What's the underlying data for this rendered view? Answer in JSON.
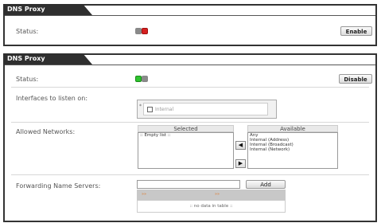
{
  "panel1": {
    "tab_title": "DNS Proxy",
    "status_label": "Status:",
    "enable_label": "Enable"
  },
  "panel2": {
    "tab_title": "DNS Proxy",
    "status_label": "Status:",
    "disable_label": "Disable",
    "interfaces_label": "Interfaces to listen on:",
    "interface_option": "Internal",
    "allowed_networks_label": "Allowed Networks:",
    "selected_header": "Selected",
    "available_header": "Available",
    "selected_items": [
      ":: Empty list ::"
    ],
    "available_items": [
      "Any",
      "Internal (Address)",
      "Internal (Broadcast)",
      "Internal (Network)"
    ],
    "forwarding_label": "Forwarding Name Servers:",
    "add_label": "Add",
    "no_data": ":: no data in table ::"
  },
  "colors": {
    "led_off_gray": "#8a8a8a",
    "led_red": "#d62020",
    "led_green": "#2ec42e",
    "tab_dark": "#2f2f2f",
    "arrow_orange": "#e07a2c"
  },
  "icons": {
    "move_left": "◀",
    "move_right": "▶",
    "sort_arrows": "»»"
  }
}
